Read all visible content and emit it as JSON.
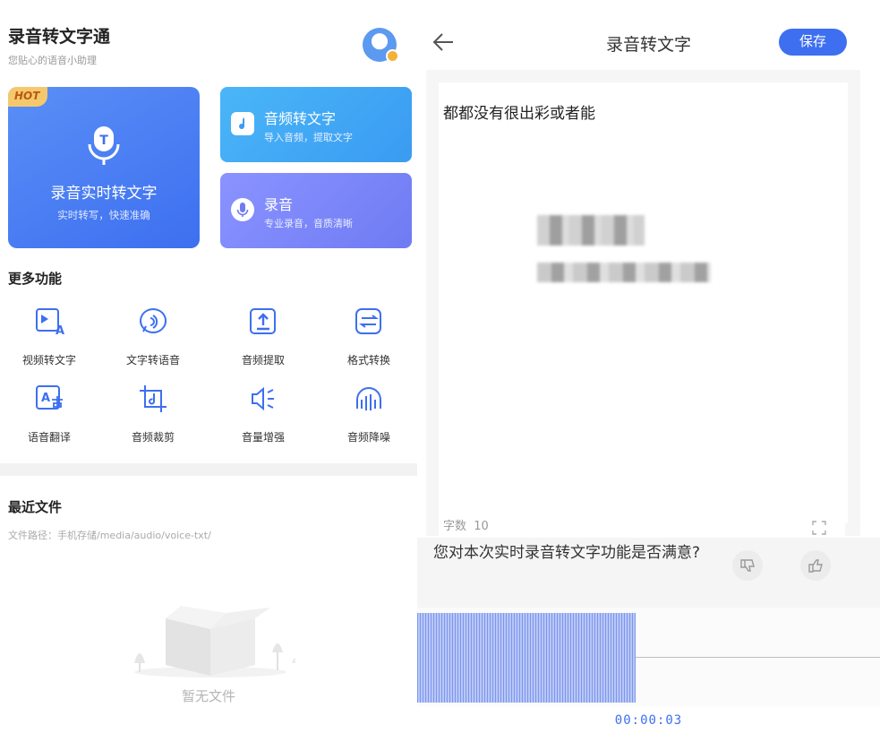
{
  "app": {
    "title": "录音转文字通",
    "subtitle": "您贴心的语音小助理"
  },
  "main_cards": {
    "realtime": {
      "badge": "HOT",
      "title": "录音实时转文字",
      "subtitle": "实时转写，快速准确"
    },
    "audio": {
      "title": "音频转文字",
      "subtitle": "导入音频，提取文字"
    },
    "record": {
      "title": "录音",
      "subtitle": "专业录音，音质清晰"
    }
  },
  "more": {
    "title": "更多功能",
    "items": [
      {
        "label": "视频转文字",
        "icon": "video-text-icon"
      },
      {
        "label": "文字转语音",
        "icon": "text-speech-icon"
      },
      {
        "label": "音频提取",
        "icon": "audio-extract-icon"
      },
      {
        "label": "格式转换",
        "icon": "format-convert-icon"
      },
      {
        "label": "语音翻译",
        "icon": "translate-icon"
      },
      {
        "label": "音频裁剪",
        "icon": "crop-icon"
      },
      {
        "label": "音量增强",
        "icon": "volume-boost-icon"
      },
      {
        "label": "音频降噪",
        "icon": "noise-reduce-icon"
      }
    ]
  },
  "recent": {
    "title": "最近文件",
    "path": "文件路径：手机存储/media/audio/voice-txt/",
    "empty": "暂无文件"
  },
  "editor": {
    "title": "录音转文字",
    "save_label": "保存",
    "transcript": "都都没有很出彩或者能",
    "word_count_label": "字数",
    "word_count": "10",
    "feedback_question": "您对本次实时录音转文字功能是否满意?",
    "timer": "00:00:03"
  },
  "colors": {
    "primary": "#3d6ff0",
    "audio_card": "#4ab6f8",
    "record_card": "#7f89fa",
    "hot_badge": "#f6c86d"
  }
}
